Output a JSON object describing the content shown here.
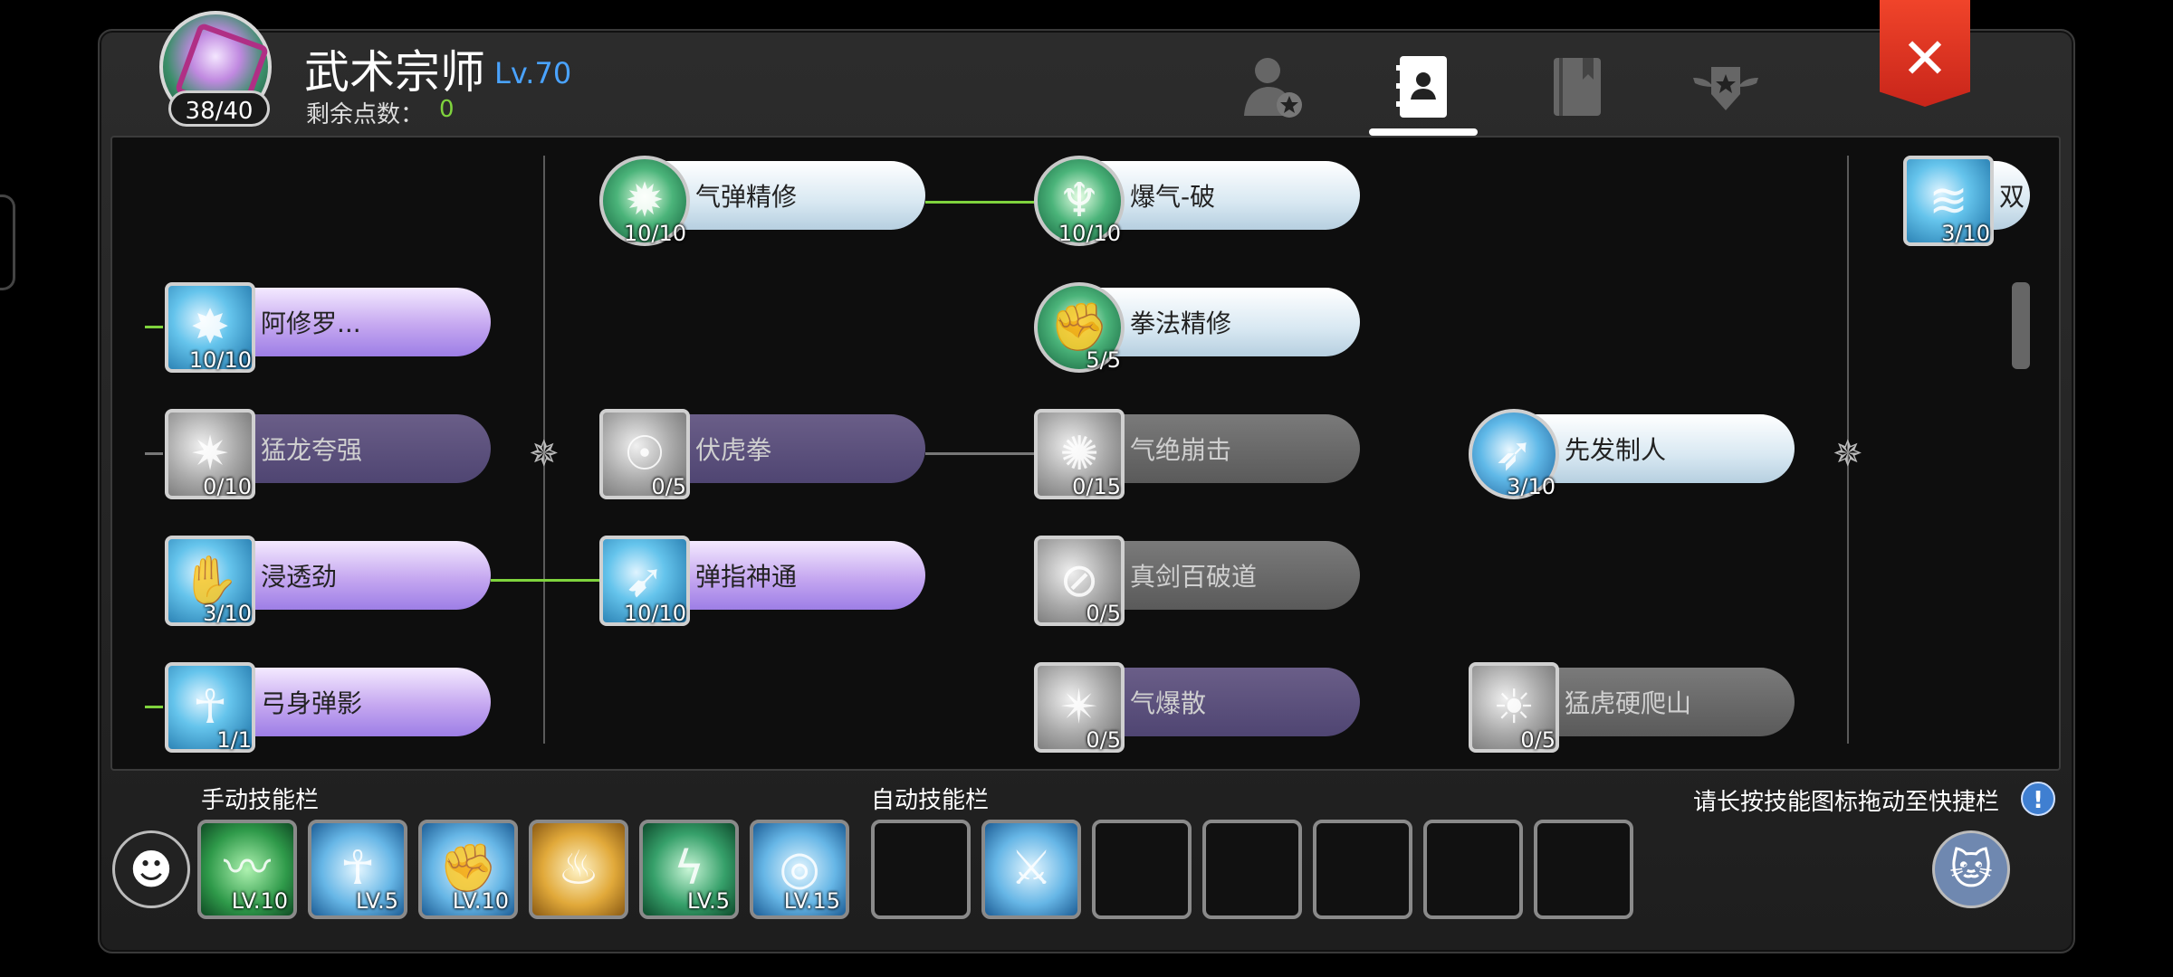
{
  "header": {
    "class_name": "武术宗师",
    "level": "Lv.70",
    "points_badge": "38/40",
    "remaining_label": "剩余点数：",
    "remaining_value": "0",
    "tabs": [
      {
        "icon": "person-star-icon"
      },
      {
        "icon": "contact-book-icon",
        "active": true
      },
      {
        "icon": "book-icon"
      },
      {
        "icon": "winged-star-badge-icon"
      }
    ],
    "close_glyph": "✕"
  },
  "skills": [
    {
      "name": "气弹精修",
      "level": "10/10"
    },
    {
      "name": "爆气-破",
      "level": "10/10"
    },
    {
      "name": "双",
      "level": "3/10"
    },
    {
      "name": "阿修罗...",
      "level": "10/10"
    },
    {
      "name": "拳法精修",
      "level": "5/5"
    },
    {
      "name": "猛龙夸强",
      "level": "0/10"
    },
    {
      "name": "伏虎拳",
      "level": "0/5"
    },
    {
      "name": "气绝崩击",
      "level": "0/15"
    },
    {
      "name": "先发制人",
      "level": "3/10"
    },
    {
      "name": "浸透劲",
      "level": "3/10"
    },
    {
      "name": "弹指神通",
      "level": "10/10"
    },
    {
      "name": "真剑百破道",
      "level": "0/5"
    },
    {
      "name": "弓身弹影",
      "level": "1/1"
    },
    {
      "name": "气爆散",
      "level": "0/5"
    },
    {
      "name": "猛虎硬爬山",
      "level": "0/5"
    }
  ],
  "manual_bar": {
    "label": "手动技能栏",
    "slots": [
      {
        "level": "LV.10"
      },
      {
        "level": "LV.5"
      },
      {
        "level": "LV.10"
      },
      {
        "level": ""
      },
      {
        "level": "LV.5"
      },
      {
        "level": "LV.15"
      }
    ]
  },
  "auto_bar": {
    "label": "自动技能栏"
  },
  "hint": "请长按技能图标拖动至快捷栏",
  "info_glyph": "!"
}
